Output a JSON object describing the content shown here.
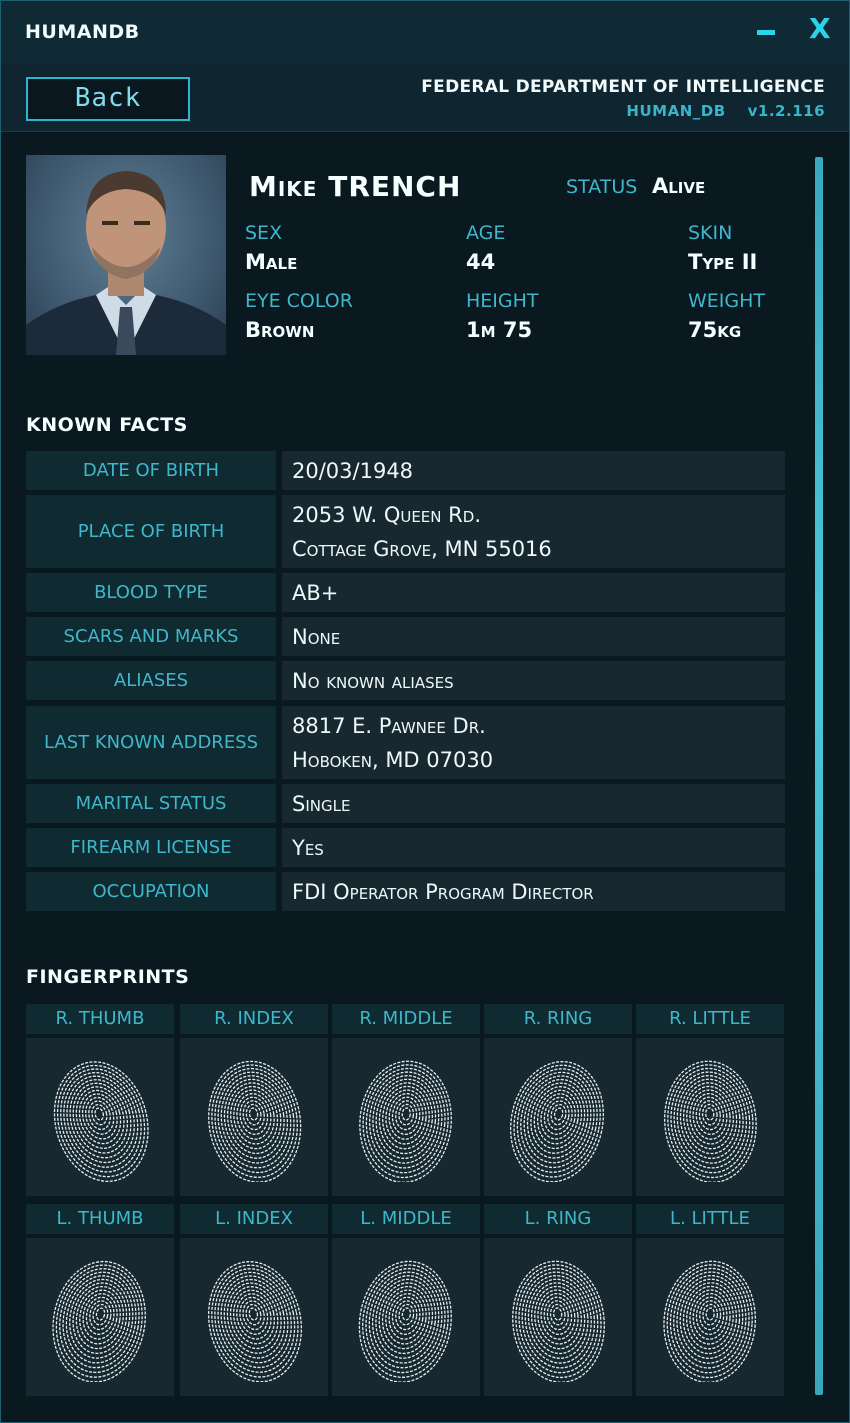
{
  "window": {
    "app_title": "HUMANDB",
    "close_label": "X"
  },
  "header": {
    "back_label": "Back",
    "department": "FEDERAL DEPARTMENT OF INTELLIGENCE",
    "db_name": "HUMAN_DB",
    "version": "v1.2.116"
  },
  "profile": {
    "name": "Mike TRENCH",
    "status_label": "STATUS",
    "status_value": "Alive",
    "sex_label": "SEX",
    "sex_value": "Male",
    "age_label": "AGE",
    "age_value": "44",
    "skin_label": "SKIN",
    "skin_value": "Type II",
    "eye_label": "EYE COLOR",
    "eye_value": "Brown",
    "height_label": "HEIGHT",
    "height_value": "1m 75",
    "weight_label": "WEIGHT",
    "weight_value": "75kg"
  },
  "facts": {
    "title": "KNOWN FACTS",
    "rows": [
      {
        "label": "DATE OF BIRTH",
        "lines": [
          "20/03/1948"
        ]
      },
      {
        "label": "PLACE OF BIRTH",
        "lines": [
          "2053 W. Queen Rd.",
          "Cottage Grove, MN 55016"
        ]
      },
      {
        "label": "BLOOD TYPE",
        "lines": [
          "AB+"
        ]
      },
      {
        "label": "SCARS AND MARKS",
        "lines": [
          "None"
        ]
      },
      {
        "label": "ALIASES",
        "lines": [
          "No known aliases"
        ]
      },
      {
        "label": "LAST KNOWN ADDRESS",
        "lines": [
          "8817 E. Pawnee Dr.",
          "Hoboken, MD 07030"
        ]
      },
      {
        "label": "MARITAL STATUS",
        "lines": [
          "Single"
        ]
      },
      {
        "label": "FIREARM LICENSE",
        "lines": [
          "Yes"
        ]
      },
      {
        "label": "OCCUPATION",
        "lines": [
          "FDI Operator Program Director"
        ]
      }
    ]
  },
  "fingerprints": {
    "title": "FINGERPRINTS",
    "right": [
      "R. THUMB",
      "R. INDEX",
      "R. MIDDLE",
      "R. RING",
      "R. LITTLE"
    ],
    "left": [
      "L. THUMB",
      "L. INDEX",
      "L. MIDDLE",
      "L. RING",
      "L. LITTLE"
    ]
  },
  "colors": {
    "accent": "#2ad4ea",
    "label": "#3fb7ca",
    "panel": "#172830",
    "label_panel": "#0f2a31"
  }
}
